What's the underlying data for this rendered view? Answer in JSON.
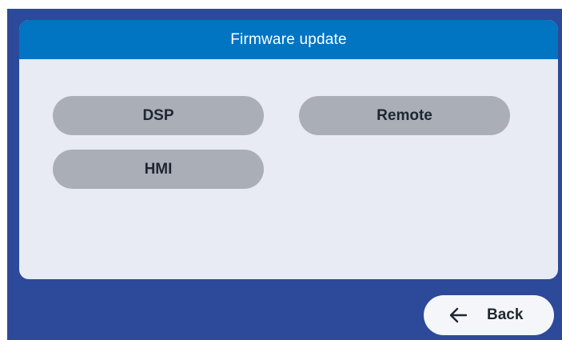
{
  "panel": {
    "title": "Firmware update"
  },
  "firmware_buttons": [
    {
      "label": "DSP"
    },
    {
      "label": "Remote"
    },
    {
      "label": "HMI"
    }
  ],
  "footer": {
    "back_label": "Back",
    "back_icon": "arrow-left-icon"
  },
  "colors": {
    "background": "#2c4a99",
    "header": "#0174c2",
    "panel": "#e8ebf3",
    "button": "#aaaeb7",
    "back_button": "#f5f6fa"
  }
}
